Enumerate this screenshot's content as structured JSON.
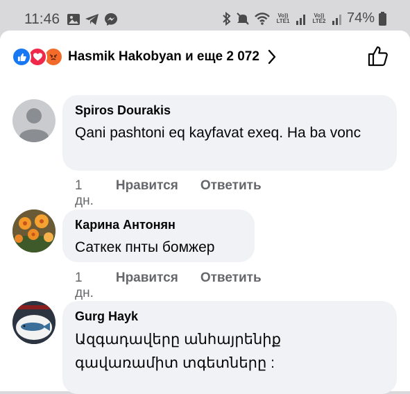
{
  "status": {
    "time": "11:46",
    "lte1": "Vo)) LTE1",
    "lte2": "Vo)) LTE2",
    "battery": "74%"
  },
  "header": {
    "reactors": "Hasmik Hakobyan и еще 2 072"
  },
  "comments": [
    {
      "author": "Spiros Dourakis",
      "text": "Qani pashtoni eq kayfavat exeq. Ha ba vonc",
      "time": "1 дн.",
      "like_label": "Нравится",
      "reply_label": "Ответить"
    },
    {
      "author": "Карина Антонян",
      "text": "Саткек пнты бомжер",
      "time": "1 дн.",
      "like_label": "Нравится",
      "reply_label": "Ответить"
    },
    {
      "author": "Gurg Hayk",
      "text": "Ազգադավերը անհայրենիք գավառամիտ տգետները :",
      "time": "",
      "like_label": "",
      "reply_label": ""
    }
  ],
  "colors": {
    "like_blue": "#1877f2",
    "love_red": "#f0284a",
    "angry_orange": "#f36b2b",
    "bubble_bg": "#f0f2f5",
    "meta_gray": "#65676b"
  }
}
